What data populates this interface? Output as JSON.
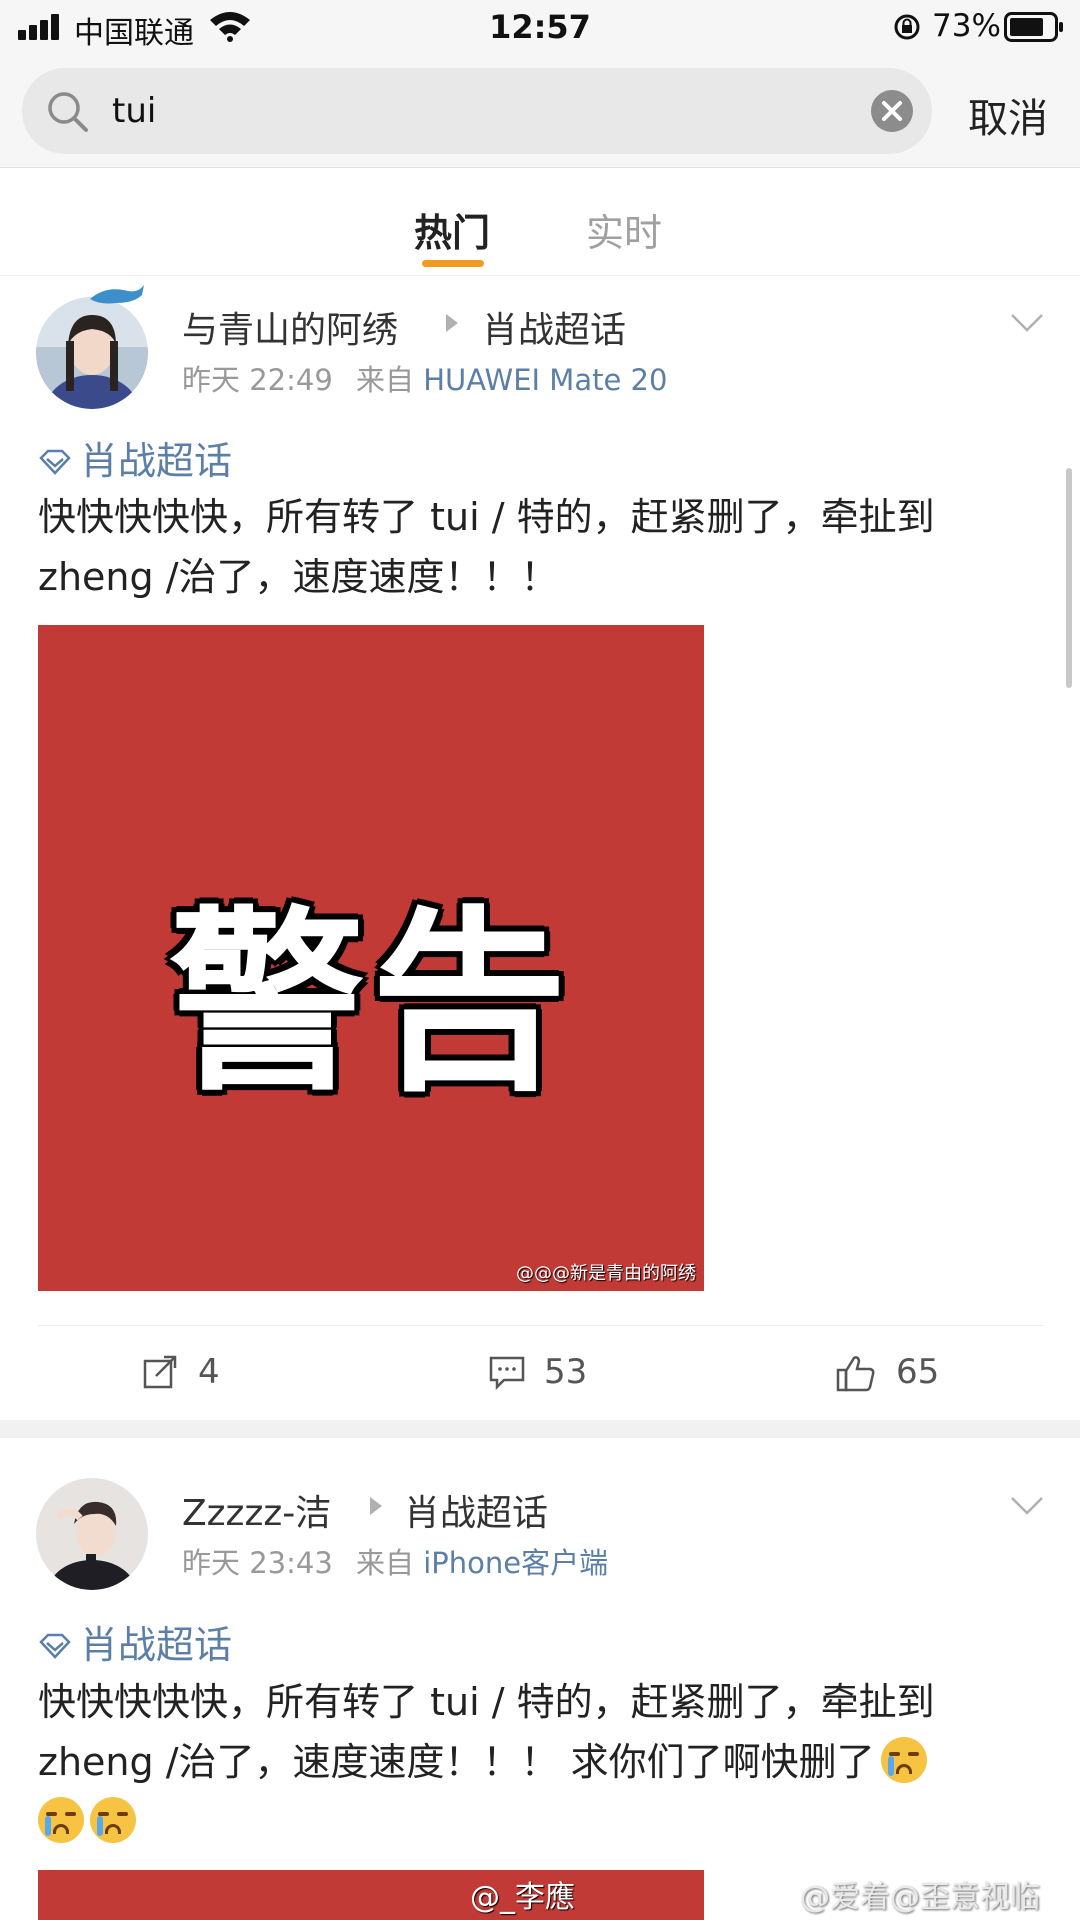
{
  "status_bar": {
    "carrier": "中国联通",
    "time": "12:57",
    "battery": "73%"
  },
  "search": {
    "query": "tui",
    "cancel_label": "取消"
  },
  "tabs": [
    {
      "label": "热门",
      "active": true
    },
    {
      "label": "实时",
      "active": false
    }
  ],
  "posts": [
    {
      "user": "与青山的阿绣",
      "topic": "肖战超话",
      "time": "昨天 22:49",
      "from_label": "来自",
      "source": "HUAWEI Mate 20",
      "tag": "肖战超话",
      "text_line1": "快快快快快，所有转了 tui / 特的，赶紧删了，牵扯到",
      "text_line2": "zheng /治了，速度速度！！！",
      "image_text": "警告",
      "image_watermark": "@@@新是青由的阿绣",
      "repost_count": "4",
      "comment_count": "53",
      "like_count": "65"
    },
    {
      "user": "Zzzzz-洁",
      "topic": "肖战超话",
      "time": "昨天 23:43",
      "from_label": "来自",
      "source": "iPhone客户端",
      "tag": "肖战超话",
      "text_line1": "快快快快快，所有转了 tui / 特的，赶紧删了，牵扯到",
      "text_line2": "zheng /治了，速度速度！！！ 求你们了啊快删了",
      "image_watermark": "@_李應"
    }
  ],
  "corner_watermark": "@爱着@歪意视临",
  "colors": {
    "accent_orange": "#f29b21",
    "link_blue": "#5b7fa6",
    "warning_red": "#c13a36"
  }
}
